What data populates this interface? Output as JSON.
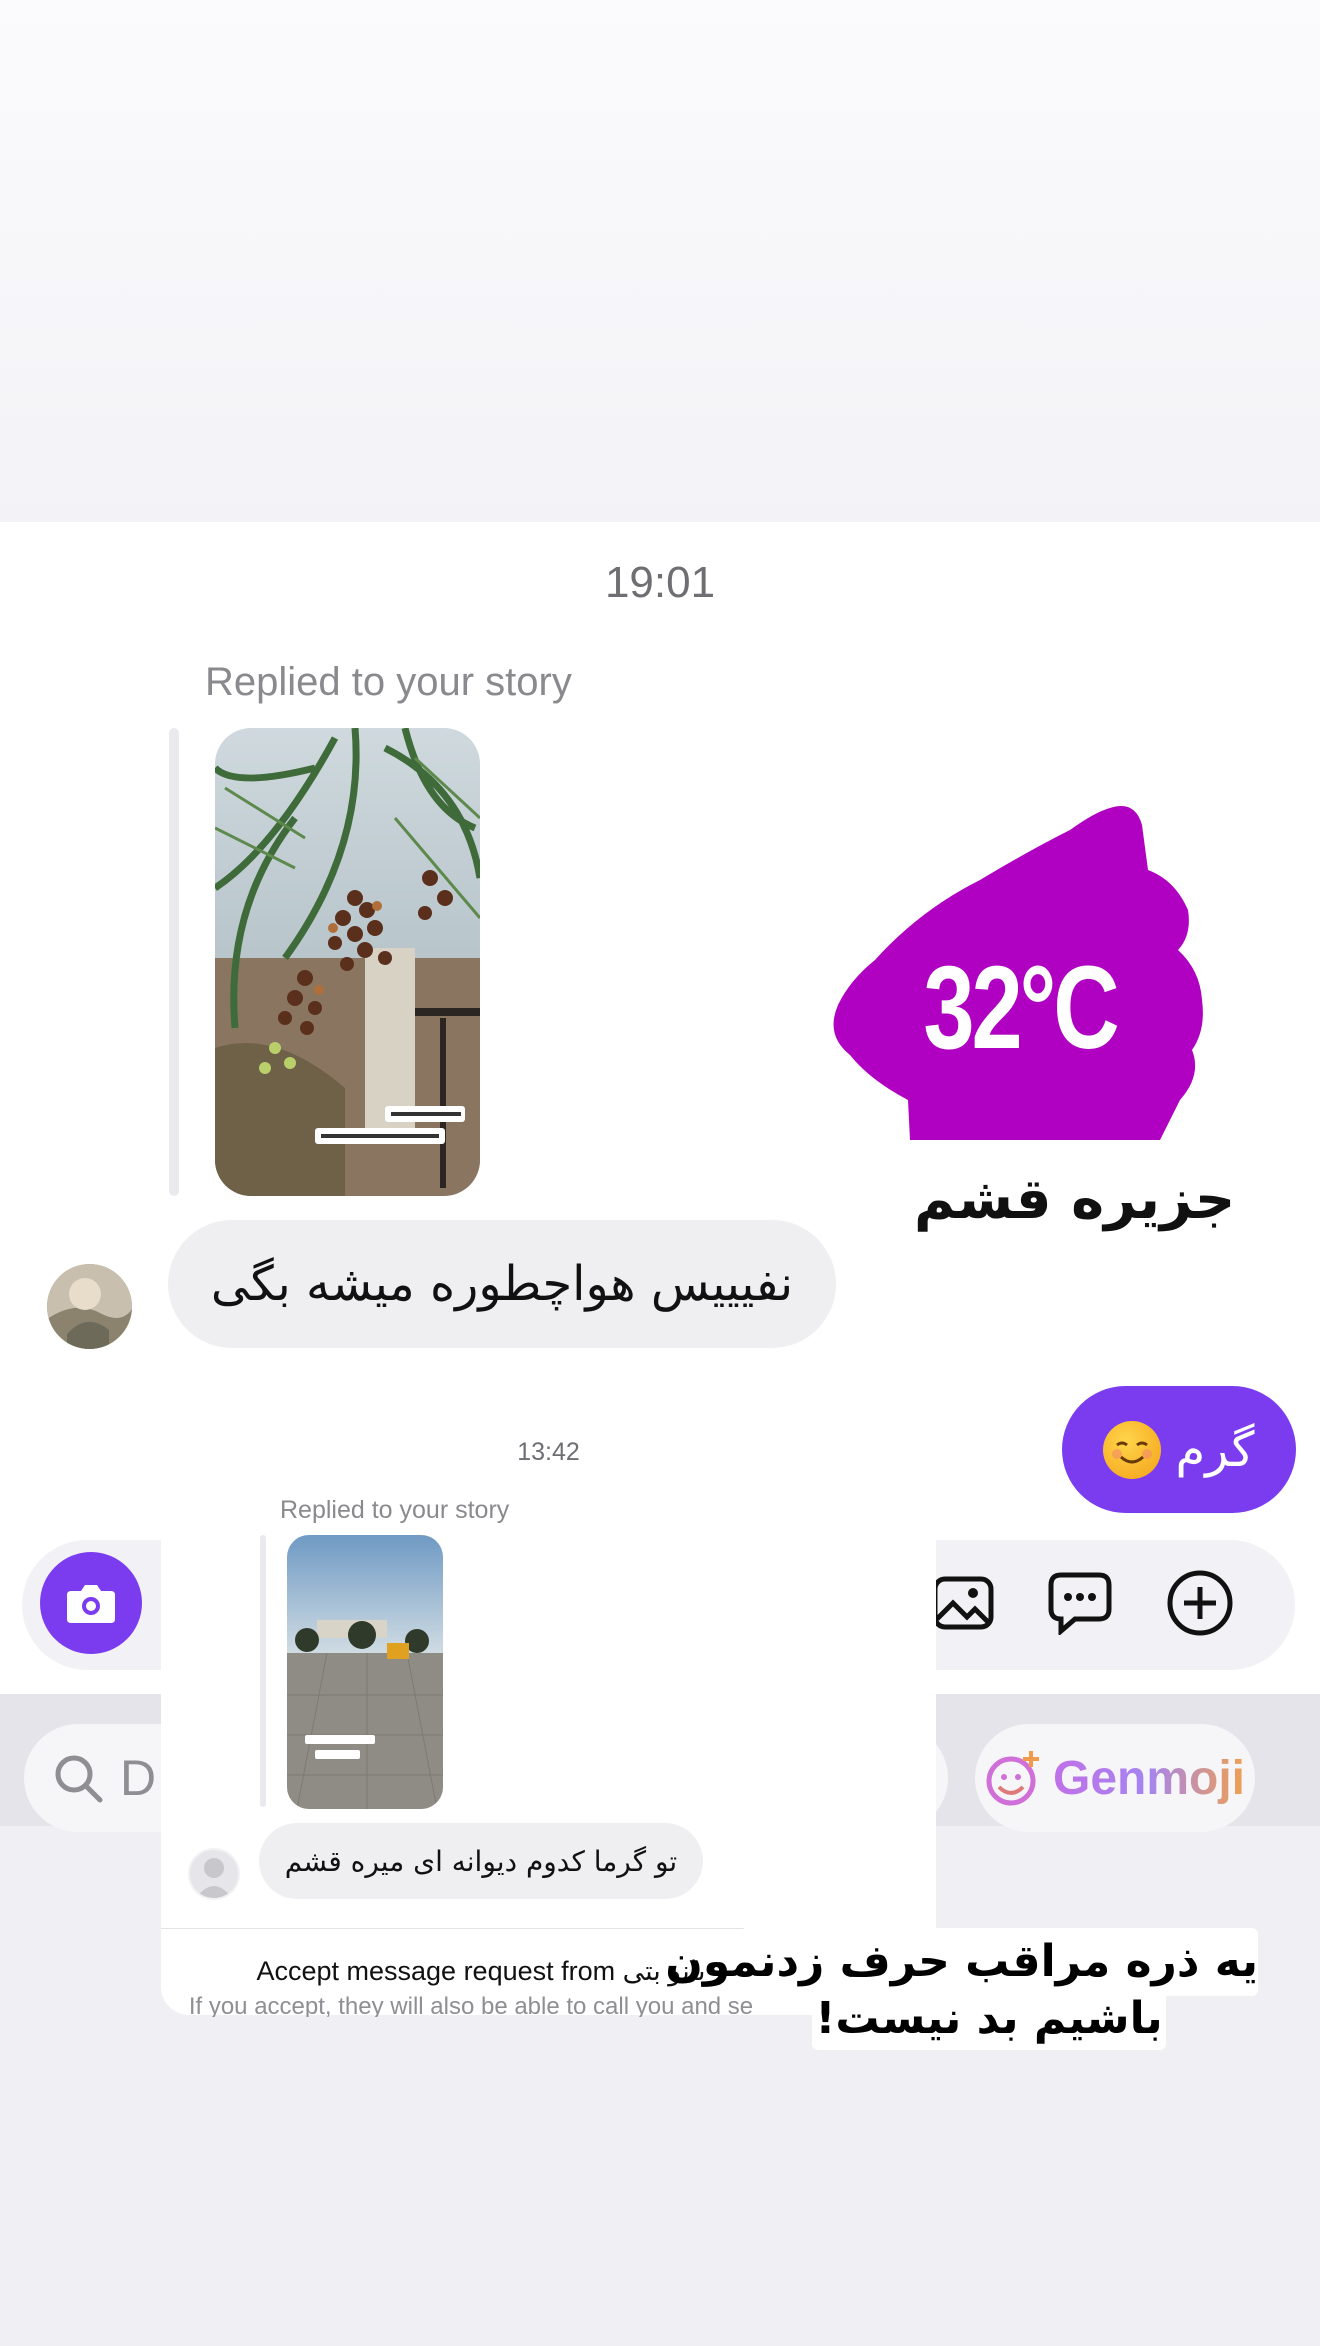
{
  "chat": {
    "timestamp": "19:01",
    "replied_label": "Replied to your story",
    "sticker": {
      "temperature": "32°C",
      "location": "جزیره قشم",
      "color": "#b000c2"
    },
    "incoming_message": "نفیییس هواچطوره میشه بگی",
    "outgoing_message": "گرم",
    "outgoing_emoji": "smiling-face",
    "accent_color": "#7b3cf0"
  },
  "composer": {
    "camera_icon": "camera-icon",
    "gallery_icon": "image-icon",
    "sticker_icon": "chat-bubble-icon",
    "add_icon": "plus-circle-icon"
  },
  "keyboard": {
    "search_placeholder": "D",
    "genmoji_label": "Genmoji"
  },
  "overlay": {
    "timestamp": "13:42",
    "replied_label": "Replied to your story",
    "incoming_message": "تو گرما کدوم دیوانه ای میره قشم",
    "accept_title": "Accept message request from بانو بتی",
    "accept_subtitle": "If you accept, they will also be able to call you and se"
  },
  "caption": {
    "line1": "یه ذره مراقب حرف زدنمون",
    "line2": "باشیم بد نیست!"
  }
}
